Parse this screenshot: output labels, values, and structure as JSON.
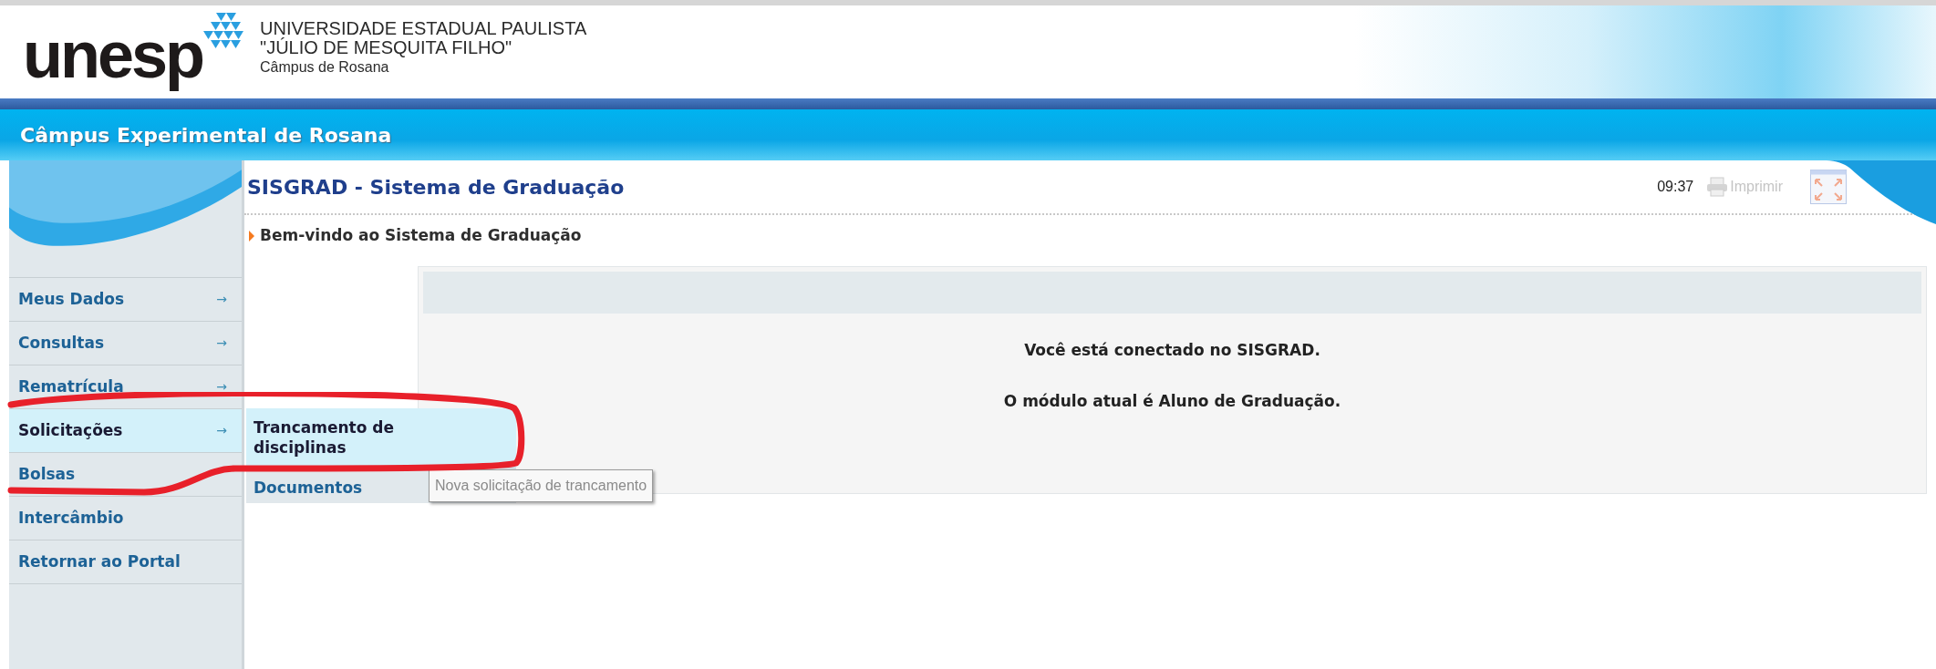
{
  "header": {
    "logo_text": "unesp",
    "university_lines": [
      "UNIVERSIDADE ESTADUAL PAULISTA",
      "\"JÚLIO DE MESQUITA FILHO\""
    ],
    "campus": "Câmpus de Rosana"
  },
  "banner": {
    "title": "Câmpus Experimental de Rosana"
  },
  "page": {
    "title": "SISGRAD - Sistema de Graduação",
    "time": "09:37",
    "print": {
      "label": "Imprimir",
      "disabled": true
    },
    "breadcrumb": "Bem-vindo ao Sistema de Graduação"
  },
  "sidebar": {
    "items": [
      {
        "label": "Meus Dados",
        "arrow": "→",
        "selected": false
      },
      {
        "label": "Consultas",
        "arrow": "→",
        "selected": false
      },
      {
        "label": "Rematrícula",
        "arrow": "→",
        "selected": false
      },
      {
        "label": "Solicitações",
        "arrow": "→",
        "selected": true
      },
      {
        "label": "Bolsas",
        "selected": false
      },
      {
        "label": "Intercâmbio",
        "selected": false
      },
      {
        "label": "Retornar ao Portal",
        "selected": false
      }
    ]
  },
  "submenu": {
    "items": [
      {
        "label": "Trancamento de disciplinas",
        "selected": true
      },
      {
        "label": "Documentos",
        "selected": false
      }
    ]
  },
  "tooltip": "Nova solicitação de trancamento",
  "panel": {
    "messages": [
      "Você está conectado no SISGRAD.",
      "O módulo atual é Aluno de Graduação."
    ]
  },
  "annotation": {
    "kind": "loop"
  }
}
